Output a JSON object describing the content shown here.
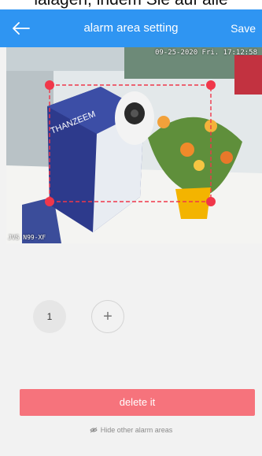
{
  "top_caption": "lalagen, indem Sie auf alle",
  "header": {
    "title": "alarm area setting",
    "save_label": "Save"
  },
  "video": {
    "timestamp": "09-25-2020 Fri. 17:12:58",
    "camera_name": "JVS N99-XF",
    "box_brand": "THANZEEM"
  },
  "areas": {
    "items": [
      "1"
    ],
    "add_label": "+"
  },
  "delete_label": "delete it",
  "hide_label": "Hide other alarm areas",
  "colors": {
    "header": "#2f95f2",
    "alarm_marker": "#f0374a",
    "delete_button": "#f6737c"
  }
}
